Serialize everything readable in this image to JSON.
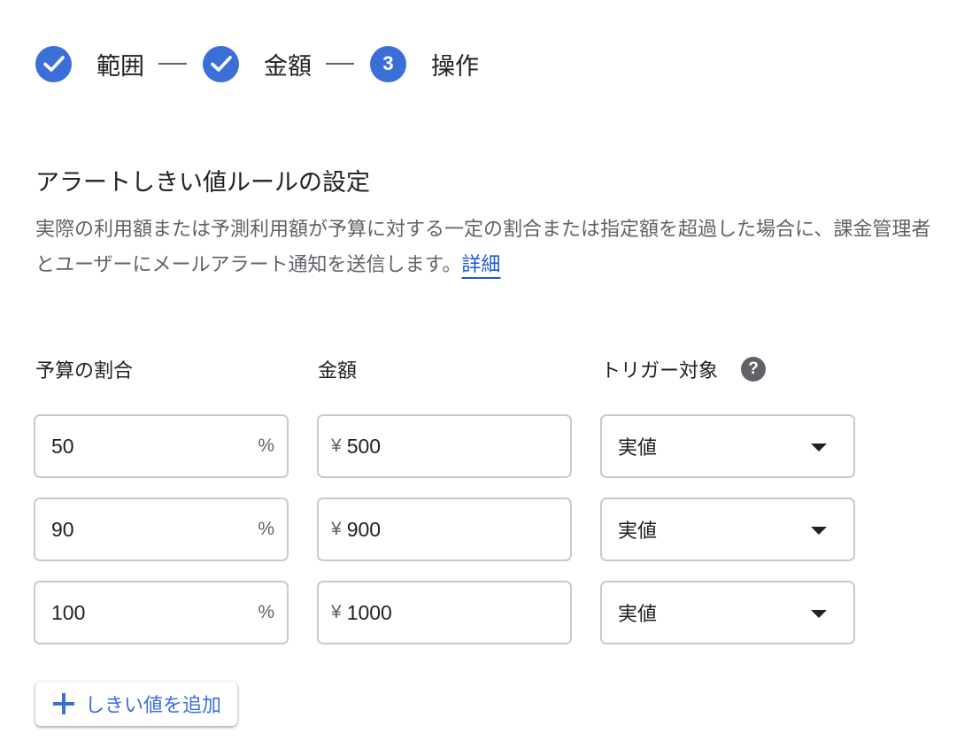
{
  "stepper": {
    "steps": [
      {
        "label": "範囲",
        "state": "done"
      },
      {
        "label": "金額",
        "state": "done"
      },
      {
        "label": "操作",
        "state": "current",
        "number": "3"
      }
    ]
  },
  "section": {
    "title": "アラートしきい値ルールの設定",
    "description": "実際の利用額または予測利用額が予算に対する一定の割合または指定額を超過した場合に、課金管理者とユーザーにメールアラート通知を送信します。",
    "learn_more": "詳細"
  },
  "columns": {
    "percent": "予算の割合",
    "amount": "金額",
    "trigger": "トリガー対象"
  },
  "thresholds": [
    {
      "percent": "50",
      "percent_suffix": "%",
      "currency": "¥",
      "amount": "500",
      "trigger": "実値"
    },
    {
      "percent": "90",
      "percent_suffix": "%",
      "currency": "¥",
      "amount": "900",
      "trigger": "実値"
    },
    {
      "percent": "100",
      "percent_suffix": "%",
      "currency": "¥",
      "amount": "1000",
      "trigger": "実値"
    }
  ],
  "add_button": {
    "label": "しきい値を追加"
  },
  "colors": {
    "accent": "#3b6fd8",
    "link": "#1a56db",
    "border": "#c8cacd"
  }
}
